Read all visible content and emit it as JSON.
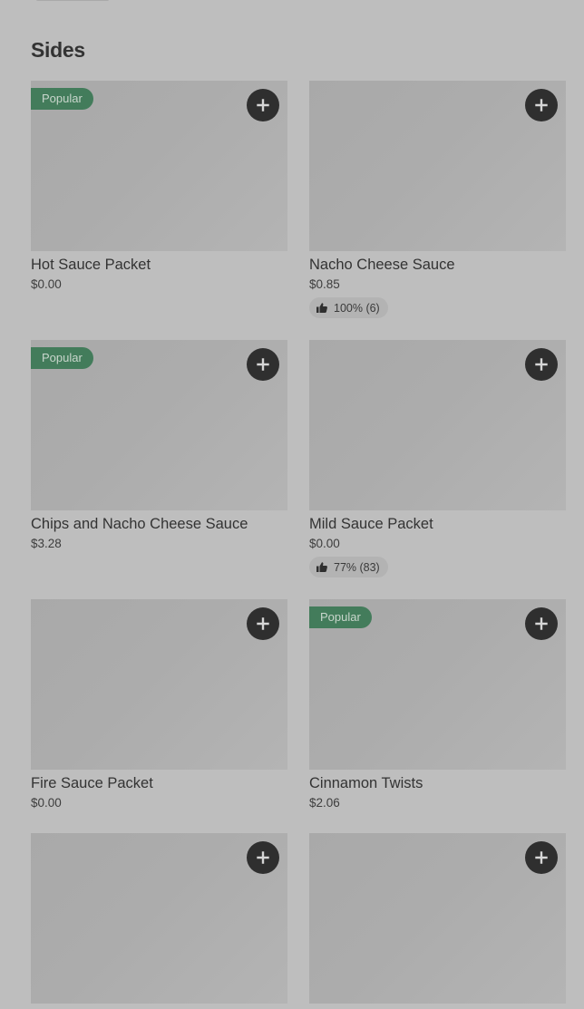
{
  "section": {
    "title": "Sides"
  },
  "items": [
    {
      "name": "Hot Sauce Packet",
      "price": "$0.00",
      "badge": "Popular",
      "rating": ""
    },
    {
      "name": "Nacho Cheese Sauce",
      "price": "$0.85",
      "badge": "",
      "rating": "100% (6)"
    },
    {
      "name": "Chips and Nacho Cheese Sauce",
      "price": "$3.28",
      "badge": "Popular",
      "rating": ""
    },
    {
      "name": "Mild Sauce Packet",
      "price": "$0.00",
      "badge": "",
      "rating": "77% (83)"
    },
    {
      "name": "Fire Sauce Packet",
      "price": "$0.00",
      "badge": "",
      "rating": ""
    },
    {
      "name": "Cinnamon Twists",
      "price": "$2.06",
      "badge": "Popular",
      "rating": ""
    },
    {
      "name": "",
      "price": "",
      "badge": "",
      "rating": ""
    },
    {
      "name": "",
      "price": "",
      "badge": "",
      "rating": ""
    }
  ],
  "icons": {
    "add": "plus-icon",
    "rating": "thumbs-up-icon"
  },
  "colors": {
    "background": "#bebebe",
    "popular_badge": "#437c5b",
    "add_button": "#2f2f2f"
  }
}
